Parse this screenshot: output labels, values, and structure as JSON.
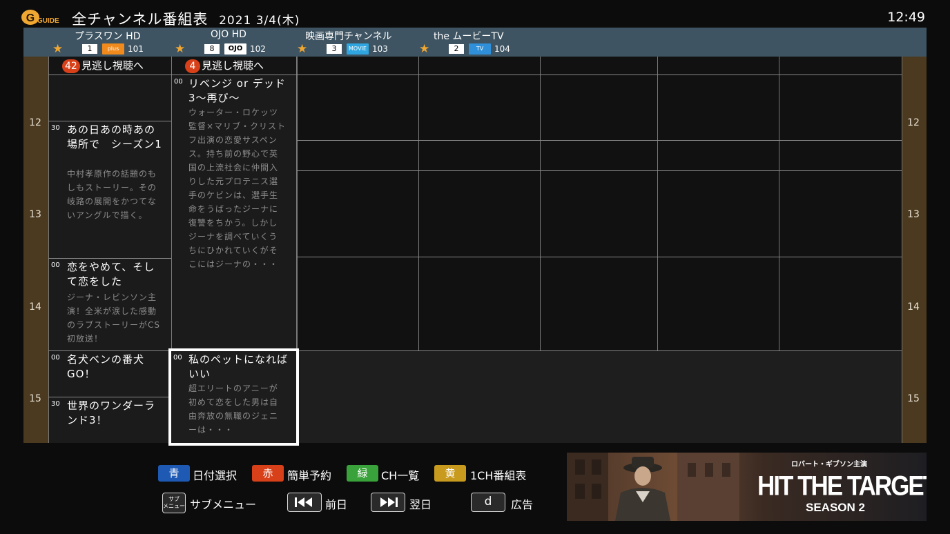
{
  "header": {
    "logo_text": "GUIDE",
    "title": "全チャンネル番組表",
    "date": "2021  3/4(木)",
    "time": "12:49"
  },
  "channels": [
    {
      "name": "プラスワン HD",
      "button": "1",
      "logo": "plus one",
      "code": "101",
      "logo_color": "#f08a1c"
    },
    {
      "name": "OJO HD",
      "button": "8",
      "logo": "OJO",
      "code": "102",
      "logo_color": "#ffffff"
    },
    {
      "name": "映画専門チャンネル",
      "button": "3",
      "logo": "MOVIE",
      "code": "103",
      "logo_color": "#2fa6e0"
    },
    {
      "name": "the ムービーTV",
      "button": "2",
      "logo": "TV",
      "code": "104",
      "logo_color": "#2f8fd8"
    }
  ],
  "hours": [
    "12",
    "13",
    "14",
    "15"
  ],
  "missed": [
    {
      "count": "42",
      "label": "見逃し視聴へ"
    },
    {
      "count": "4",
      "label": "見逃し視聴へ"
    }
  ],
  "programs": {
    "ch1_p1": {
      "min": "30",
      "title": "あの日あの時あの場所で　シーズン1",
      "desc": "中村孝原作の話題のもしもストーリー。その岐路の展開をかつてないアングルで描く。"
    },
    "ch1_p2": {
      "min": "00",
      "title": "恋をやめて、そして恋をした",
      "desc": "ジーナ・レビンソン主演！全米が涙した感動のラブストーリーがCS初放送！"
    },
    "ch1_p3": {
      "min": "00",
      "title": "名犬ベンの番犬GO！",
      "desc": ""
    },
    "ch1_p4": {
      "min": "30",
      "title": "世界のワンダーランド3！",
      "desc": ""
    },
    "ch2_p1": {
      "min": "00",
      "title": "リベンジ or デッド3～再び～",
      "desc": "ウォーター・ロケッツ監督×マリブ・クリストフ出演の恋愛サスペンス。持ち前の野心で英国の上流社会に仲間入りした元プロテニス選手のケビンは、選手生命をうばったジーナに復讐をちかう。しかしジーナを調べていくうちにひかれていくがそこにはジーナの・・・"
    },
    "ch2_p2": {
      "min": "00",
      "title": "私のペットになればいい",
      "desc": "超エリートのアニーが初めて恋をした男は自由奔放の無職のジェニーは・・・"
    }
  },
  "footer": {
    "blue": {
      "key": "青",
      "label": "日付選択",
      "color": "#1e5ab4"
    },
    "red": {
      "key": "赤",
      "label": "簡単予約",
      "color": "#d8401a"
    },
    "green": {
      "key": "緑",
      "label": "CH一覧",
      "color": "#3aa23a"
    },
    "yellow": {
      "key": "黄",
      "label": "1CH番組表",
      "color": "#c89a1e"
    },
    "sub_key": "サブ\nメニュー",
    "sub_label": "サブメニュー",
    "prev_label": "前日",
    "next_label": "翌日",
    "d_key": "d",
    "d_label": "広告"
  },
  "ad": {
    "tagline": "ロバート・ギブソン主演",
    "title": "HIT THE TARGET",
    "subtitle": "SEASON 2"
  },
  "colors": {
    "channel_bar": "#3e5462",
    "hour_gutter": "#4b3a1f",
    "star": "#f0a732",
    "focus_border": "#ffffff"
  }
}
